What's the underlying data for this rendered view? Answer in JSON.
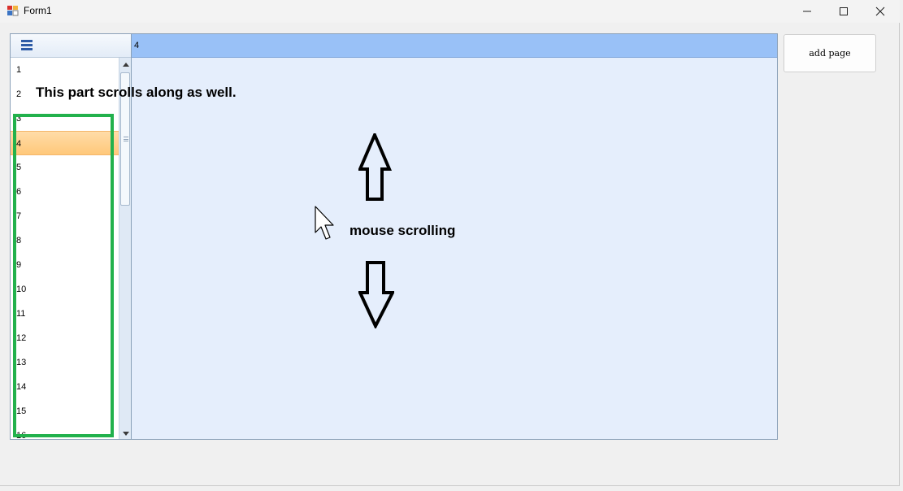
{
  "window": {
    "title": "Form1"
  },
  "navigator": {
    "items": [
      "1",
      "2",
      "3",
      "4",
      "5",
      "6",
      "7",
      "8",
      "9",
      "10",
      "11",
      "12",
      "13",
      "14",
      "15",
      "16"
    ],
    "selected": "4"
  },
  "page": {
    "header_text": "4"
  },
  "buttons": {
    "add_page": "add page"
  },
  "annotations": {
    "scroll_note": "This part scrolls along as well.",
    "mouse_note": "mouse scrolling"
  },
  "colors": {
    "highlight_box": "#22b14c",
    "page_header": "#99c1f7",
    "page_body": "#e5eefc",
    "selected_item": "#ffc87a"
  },
  "icons": {
    "menu": "hamburger-menu-icon",
    "app": "form-app-icon",
    "cursor": "mouse-pointer-icon",
    "up_arrow": "up-arrow-icon",
    "down_arrow": "down-arrow-icon"
  }
}
